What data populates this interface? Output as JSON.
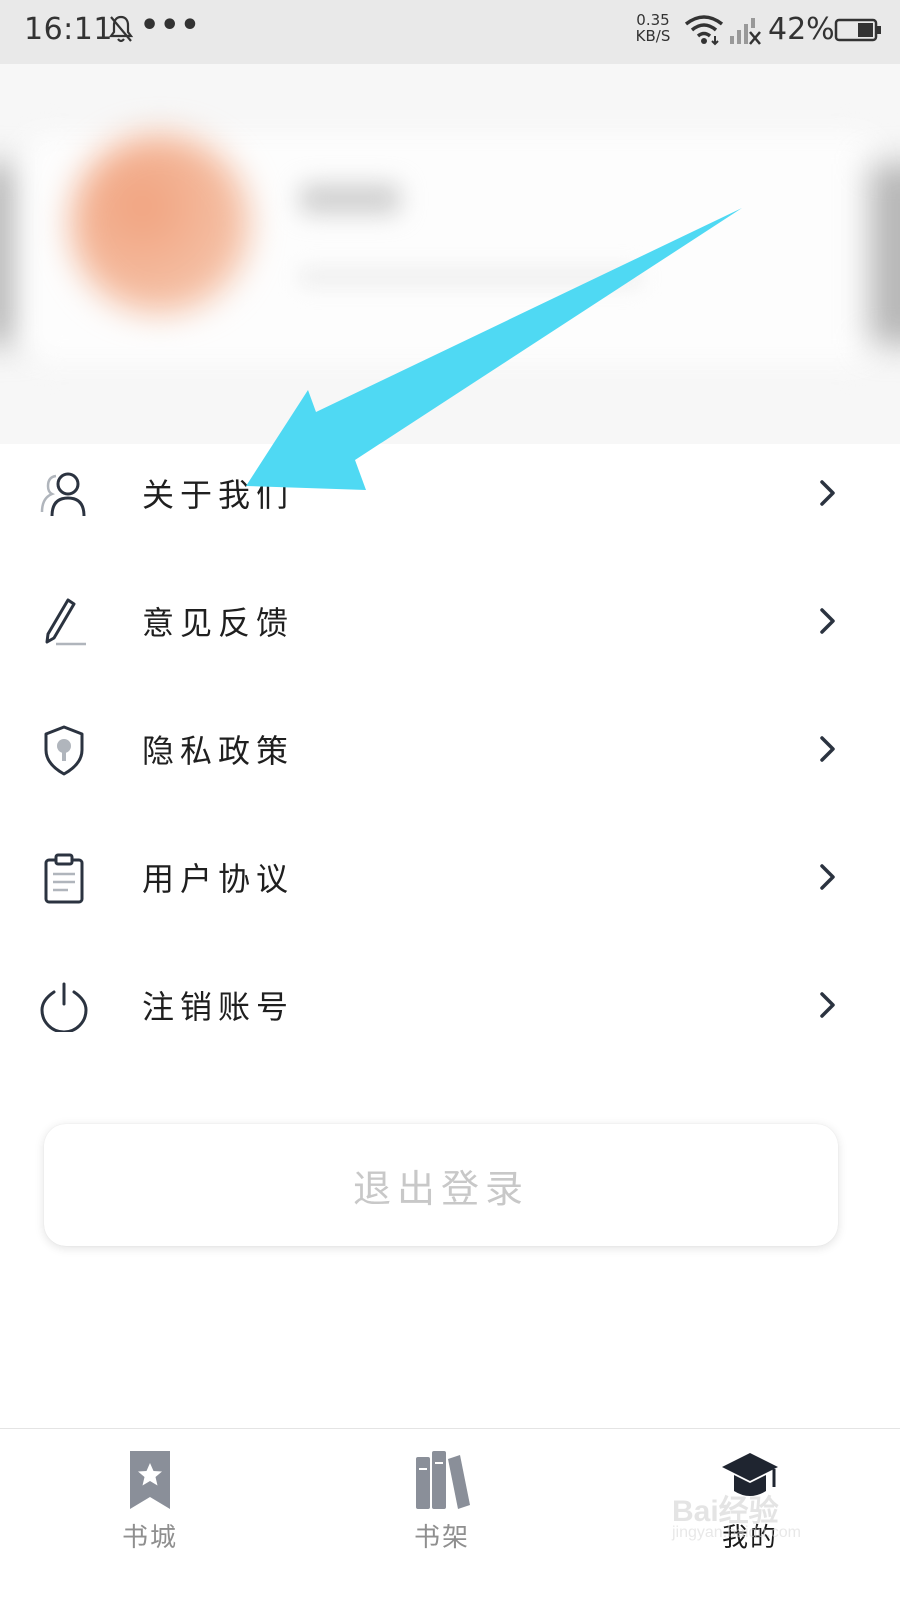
{
  "status_bar": {
    "time": "16:11",
    "dots": "•••",
    "speed_value": "0.35",
    "speed_unit": "KB/S",
    "battery": "42%"
  },
  "menu": {
    "items": [
      {
        "label": "关于我们",
        "icon": "user-icon"
      },
      {
        "label": "意见反馈",
        "icon": "pencil-icon"
      },
      {
        "label": "隐私政策",
        "icon": "shield-icon"
      },
      {
        "label": "用户协议",
        "icon": "clipboard-icon"
      },
      {
        "label": "注销账号",
        "icon": "power-icon"
      }
    ]
  },
  "logout": {
    "label": "退出登录"
  },
  "bottom_nav": {
    "items": [
      {
        "label": "书城",
        "icon": "bookmark-star-icon",
        "active": false
      },
      {
        "label": "书架",
        "icon": "books-icon",
        "active": false
      },
      {
        "label": "我的",
        "icon": "graduation-cap-icon",
        "active": true
      }
    ]
  },
  "watermark": {
    "text": "Bai经验",
    "sub": "jingyan.baidu.com"
  },
  "colors": {
    "arrow": "#4fd9f3",
    "icon": "#2b3340",
    "nav_icon": "#8a8f99",
    "logout_text": "#c8c8c8"
  }
}
